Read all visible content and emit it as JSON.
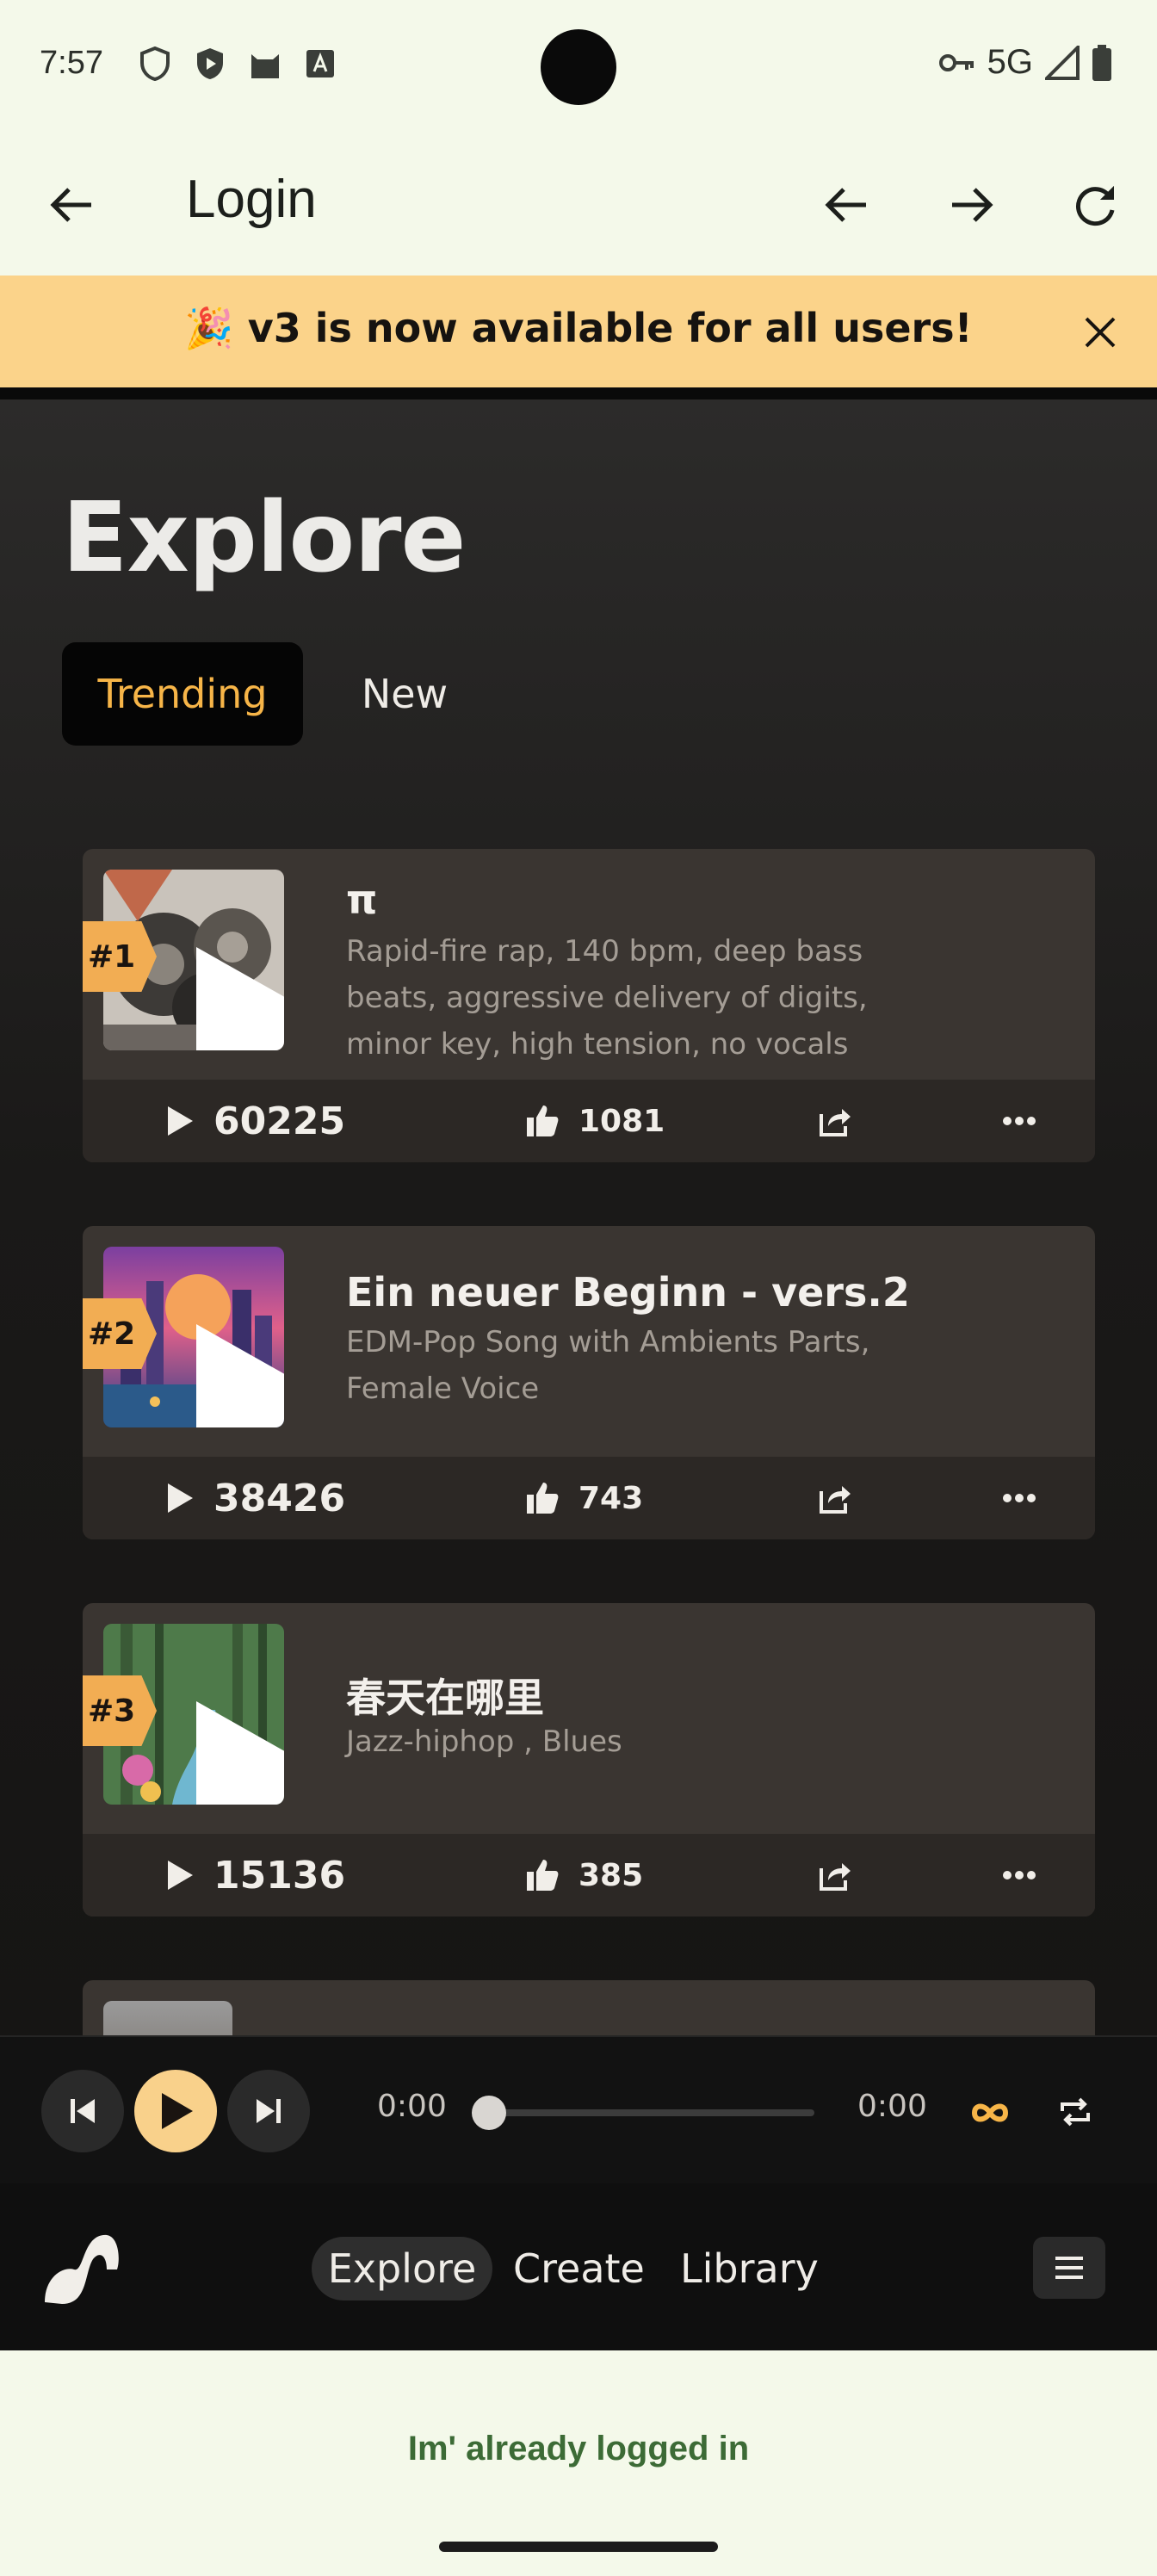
{
  "status_bar": {
    "time": "7:57",
    "network": "5G"
  },
  "toolbar": {
    "title": "Login"
  },
  "banner": {
    "text": "🎉 v3 is now available for all users!"
  },
  "explore": {
    "title": "Explore",
    "tabs": [
      {
        "label": "Trending",
        "active": true
      },
      {
        "label": "New",
        "active": false
      }
    ]
  },
  "songs": [
    {
      "rank": "#1",
      "title": "π",
      "description": "Rapid-fire rap, 140 bpm, deep bass beats, aggressive delivery of digits, minor key, high tension, no vocals",
      "plays": "60225",
      "likes": "1081"
    },
    {
      "rank": "#2",
      "title": "Ein neuer Beginn - vers.2",
      "description": "EDM-Pop Song with Ambients Parts, Female Voice",
      "plays": "38426",
      "likes": "743"
    },
    {
      "rank": "#3",
      "title": "春天在哪里",
      "description": "Jazz-hiphop , Blues",
      "plays": "15136",
      "likes": "385"
    }
  ],
  "player": {
    "current_time": "0:00",
    "duration": "0:00",
    "progress": 0
  },
  "nav": {
    "explore": "Explore",
    "create": "Create",
    "library": "Library"
  },
  "footer": {
    "link": "Im' already logged in"
  },
  "colors": {
    "accent": "#f7b548",
    "banner": "#fbd38a",
    "rank_badge": "#f2ad53"
  }
}
